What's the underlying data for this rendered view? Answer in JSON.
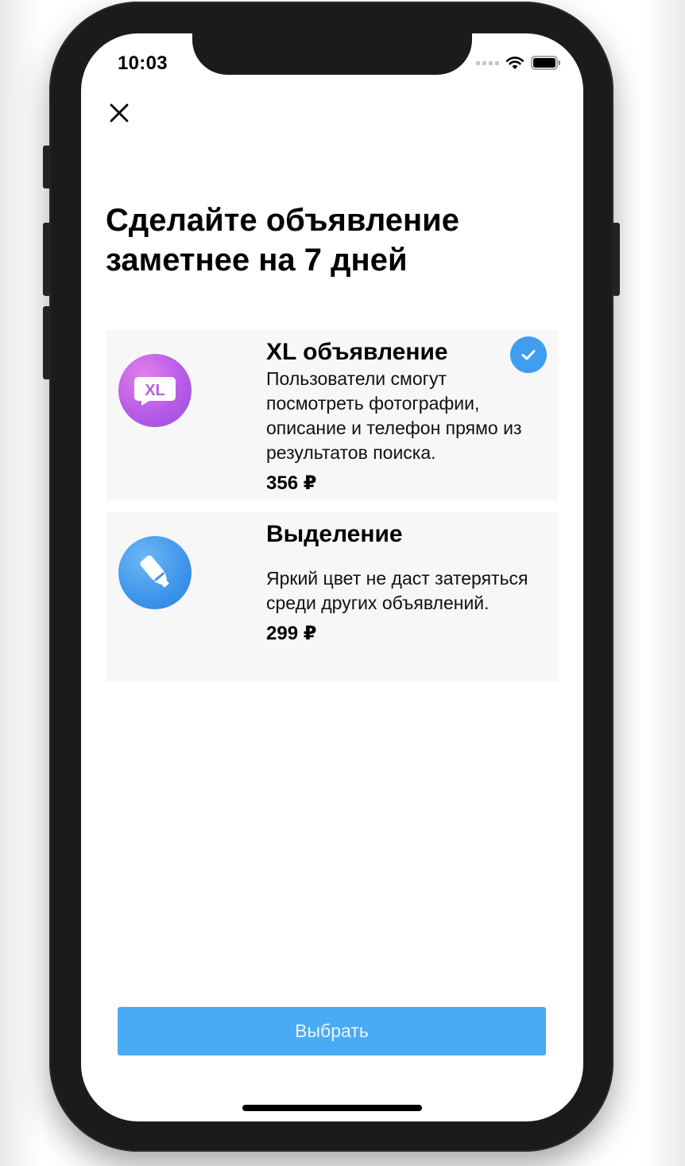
{
  "status_bar": {
    "time": "10:03"
  },
  "header": {
    "close_icon": "close-icon",
    "title": "Сделайте объявление заметнее на 7 дней"
  },
  "options": [
    {
      "icon_label": "XL",
      "title": "XL объявление",
      "description": "Пользователи смогут посмотреть фотографии, описание и телефон прямо из результатов поиска.",
      "price": "356 ₽",
      "selected": true
    },
    {
      "icon": "marker-icon",
      "title": "Выделение",
      "description": "Яркий цвет не даст затеряться среди других объявлений.",
      "price": "299 ₽",
      "selected": false
    }
  ],
  "footer": {
    "select_label": "Выбрать"
  },
  "colors": {
    "accent": "#4aabf5",
    "check": "#3f9ef0",
    "card_bg": "#f7f7f7",
    "xl_icon": "#b75ce8",
    "marker_icon": "#3e95ea"
  }
}
